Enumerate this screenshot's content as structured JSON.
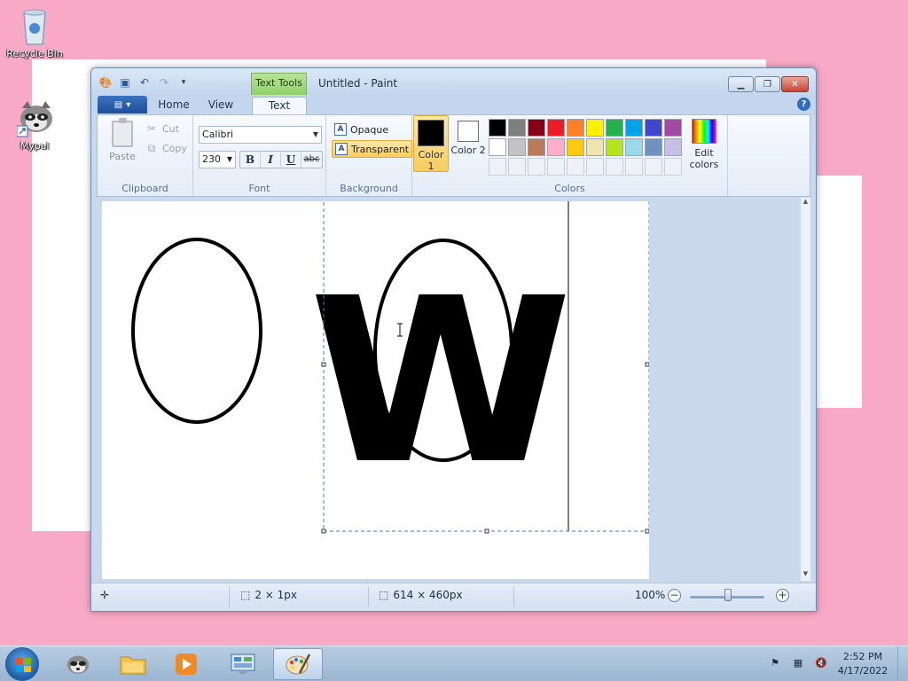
{
  "desktop": {
    "icons": [
      {
        "label": "Recycle Bin"
      },
      {
        "label": "Mypal"
      }
    ]
  },
  "window": {
    "title": "Untitled - Paint",
    "contextual_tab": "Text Tools",
    "tabs": {
      "home": "Home",
      "view": "View",
      "text": "Text"
    },
    "help": "?"
  },
  "ribbon": {
    "clipboard": {
      "label": "Clipboard",
      "paste": "Paste",
      "cut": "Cut",
      "copy": "Copy"
    },
    "font": {
      "label": "Font",
      "family": "Calibri",
      "size": "230",
      "bold": "B",
      "italic": "I",
      "underline": "U",
      "strike": "abc"
    },
    "background": {
      "label": "Background",
      "opaque": "Opaque",
      "transparent": "Transparent",
      "selected": "transparent"
    },
    "colors": {
      "label": "Colors",
      "color1_label": "Color 1",
      "color2_label": "Color 2",
      "color1": "#000000",
      "color2": "#ffffff",
      "edit_label": "Edit colors",
      "palette_row1": [
        "#000000",
        "#7f7f7f",
        "#880015",
        "#ed1c24",
        "#ff7f27",
        "#fff200",
        "#22b14c",
        "#00a2e8",
        "#3f48cc",
        "#a349a4"
      ],
      "palette_row2": [
        "#ffffff",
        "#c3c3c3",
        "#b97a57",
        "#ffaec9",
        "#ffc90e",
        "#efe4b0",
        "#b5e61d",
        "#99d9ea",
        "#7092be",
        "#c8bfe7"
      ]
    }
  },
  "canvas": {
    "text_content": "W",
    "text_color": "#000000"
  },
  "status": {
    "selection_size": "2 × 1px",
    "image_size": "614 × 460px",
    "zoom": "100%"
  },
  "taskbar": {
    "time": "2:52 PM",
    "date": "4/17/2022"
  }
}
